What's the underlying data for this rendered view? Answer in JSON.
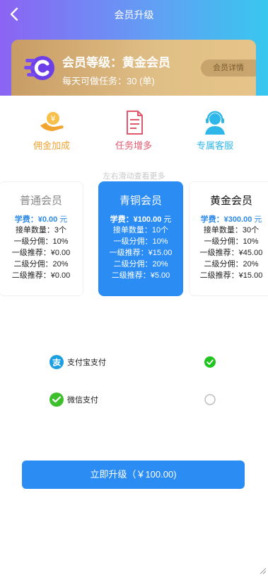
{
  "header": {
    "title": "会员升级"
  },
  "card": {
    "level_label": "会员等级：黄金会员",
    "tasks_label": "每天可做任务：30 (单)",
    "detail_button": "会员详情"
  },
  "features": [
    {
      "label": "佣金加成",
      "icon": "commission-icon",
      "color": "#f2a431"
    },
    {
      "label": "任务增多",
      "icon": "task-document-icon",
      "color": "#e05a6e"
    },
    {
      "label": "专属客服",
      "icon": "customer-service-icon",
      "color": "#2fb7ea"
    }
  ],
  "hint": "左右滑动查看更多",
  "plans": [
    {
      "name": "普通会员",
      "fee": "学费：¥0.00",
      "fee_unit": "元",
      "rows": [
        "接单数量：3个",
        "一级分佣：10%",
        "一级推荐：¥0.00",
        "二级分佣：20%",
        "二级推荐：¥0.00"
      ]
    },
    {
      "name": "青铜会员",
      "fee": "学费：¥100.00",
      "fee_unit": "元",
      "rows": [
        "接单数量：10个",
        "一级分佣：10%",
        "一级推荐：¥15.00",
        "二级分佣：20%",
        "二级推荐：¥5.00"
      ]
    },
    {
      "name": "黄金会员",
      "fee": "学费：¥300.00",
      "fee_unit": "元",
      "rows": [
        "接单数量：30个",
        "一级分佣：10%",
        "一级推荐：¥45.00",
        "二级分佣：20%",
        "二级推荐：¥15.00"
      ]
    }
  ],
  "payment": [
    {
      "label": "支付宝支付",
      "icon": "alipay-icon",
      "selected": true
    },
    {
      "label": "微信支付",
      "icon": "wechat-pay-icon",
      "selected": false
    }
  ],
  "submit_button": "立即升级（￥100.00)",
  "colors": {
    "accent": "#2b8cf4",
    "gold": "#d9b57c",
    "check": "#1fc41f"
  }
}
